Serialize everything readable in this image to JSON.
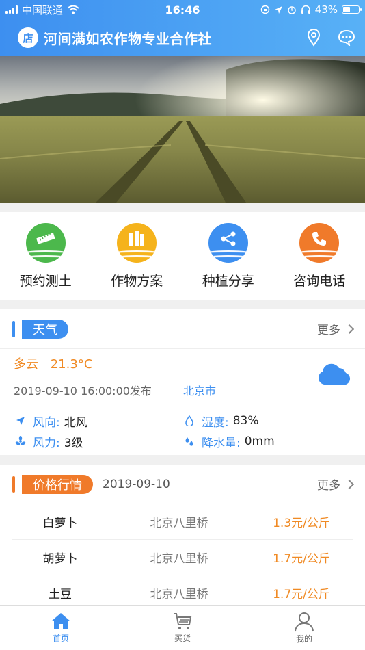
{
  "status_bar": {
    "carrier": "中国联通",
    "time": "16:46",
    "battery": "43%",
    "battery_level": 0.43
  },
  "header": {
    "logo_text": "店",
    "title": "河间满如农作物专业合作社",
    "icons": [
      "location-pin-icon",
      "chat-bubble-icon"
    ]
  },
  "banner": {
    "image": "wheat-field-sunrise"
  },
  "shortcuts": [
    {
      "label": "预约测土",
      "icon": "ruler-soil-icon",
      "color": "#4cb84c"
    },
    {
      "label": "作物方案",
      "icon": "books-icon",
      "color": "#f5b31c"
    },
    {
      "label": "种植分享",
      "icon": "share-icon",
      "color": "#3d8ff0"
    },
    {
      "label": "咨询电话",
      "icon": "phone-icon",
      "color": "#f07a2a"
    }
  ],
  "weather": {
    "section_title": "天气",
    "more": "更多",
    "condition": "多云",
    "temperature": "21.3°C",
    "published": "2019-09-10 16:00:00发布",
    "city": "北京市",
    "wind_dir_label": "风向:",
    "wind_dir": "北风",
    "humidity_label": "湿度:",
    "humidity": "83%",
    "wind_power_label": "风力:",
    "wind_power": "3级",
    "precip_label": "降水量:",
    "precip": "0mm",
    "colors": {
      "accent": "#3d8ff0",
      "temp": "#f08a24"
    }
  },
  "prices": {
    "section_title": "价格行情",
    "date": "2019-09-10",
    "more": "更多",
    "rows": [
      {
        "name": "白萝卜",
        "market": "北京八里桥",
        "price": "1.3元/公斤"
      },
      {
        "name": "胡萝卜",
        "market": "北京八里桥",
        "price": "1.7元/公斤"
      },
      {
        "name": "土豆",
        "market": "北京八里桥",
        "price": "1.7元/公斤"
      }
    ]
  },
  "tabbar": [
    {
      "label": "首页",
      "icon": "home-icon",
      "active": true
    },
    {
      "label": "买货",
      "icon": "cart-icon",
      "active": false
    },
    {
      "label": "我的",
      "icon": "user-icon",
      "active": false
    }
  ]
}
